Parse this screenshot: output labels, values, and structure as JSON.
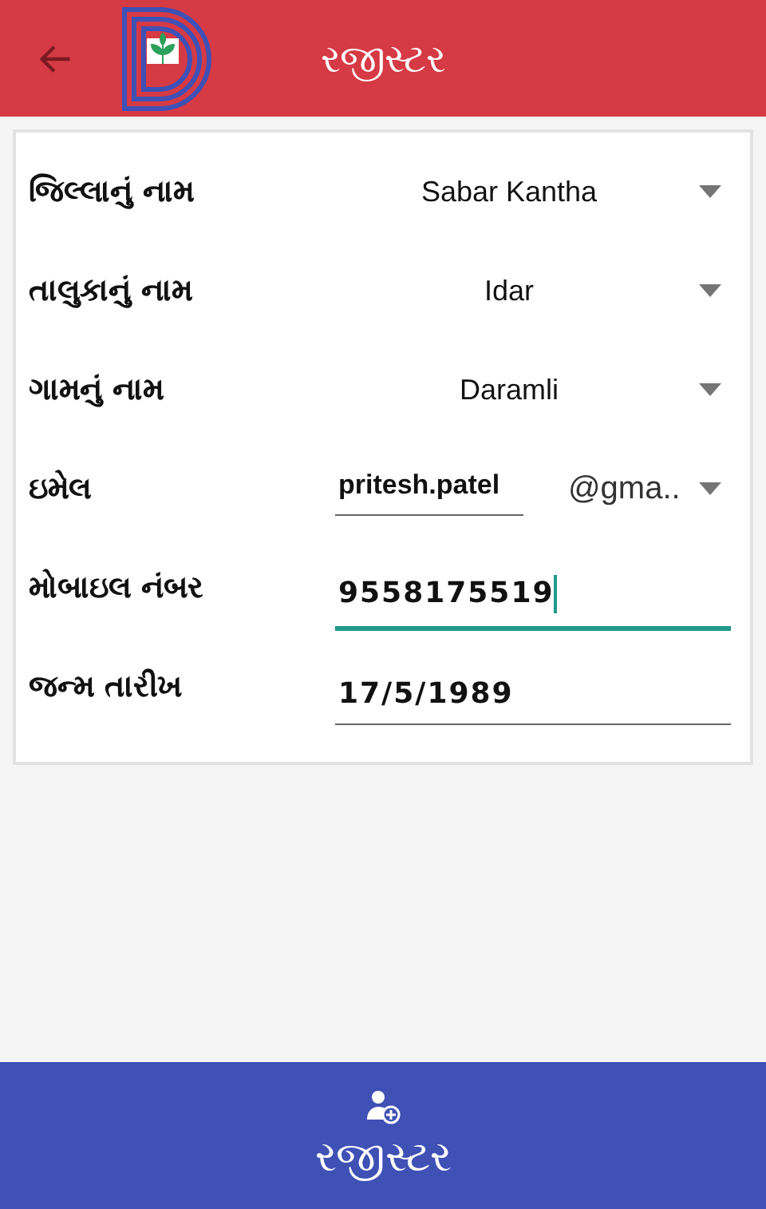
{
  "header": {
    "title": "રજીસ્ટર"
  },
  "fields": [
    {
      "kind": "dropdown",
      "label": "જિલ્લાનું નામ",
      "value": "Sabar Kantha"
    },
    {
      "kind": "dropdown",
      "label": "તાલુકાનું નામ",
      "value": "Idar"
    },
    {
      "kind": "dropdown",
      "label": "ગામનું નામ",
      "value": "Daramli"
    },
    {
      "kind": "email",
      "label": "ઇમેલ",
      "value": "pritesh.patel",
      "domain": "@gma.."
    },
    {
      "kind": "input",
      "label": "મોબાઇલ નંબર",
      "value": "9558175519",
      "focused": true
    },
    {
      "kind": "input",
      "label": "જન્મ તારીખ",
      "value": "17/5/1989",
      "focused": false
    }
  ],
  "register_button": {
    "label": "રજીસ્ટર"
  }
}
